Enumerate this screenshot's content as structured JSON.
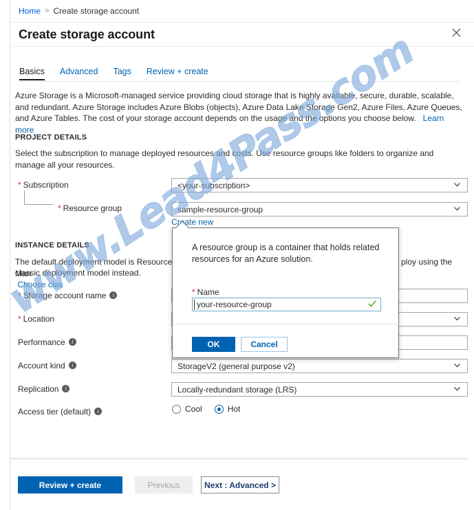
{
  "breadcrumb": {
    "home": "Home",
    "separator": ">",
    "current": "Create storage account"
  },
  "header": {
    "title": "Create storage account",
    "close_icon": "close-icon"
  },
  "tabs": [
    {
      "label": "Basics",
      "active": true
    },
    {
      "label": "Advanced",
      "active": false
    },
    {
      "label": "Tags",
      "active": false
    },
    {
      "label": "Review + create",
      "active": false
    }
  ],
  "intro": {
    "text": "Azure Storage is a Microsoft-managed service providing cloud storage that is highly available, secure, durable, scalable, and redundant. Azure Storage includes Azure Blobs (objects), Azure Data Lake Storage Gen2, Azure Files, Azure Queues, and Azure Tables. The cost of your storage account depends on the usage and the options you choose below.",
    "learn_more": "Learn more"
  },
  "project_details": {
    "heading": "PROJECT DETAILS",
    "description": "Select the subscription to manage deployed resources and costs. Use resource groups like folders to organize and manage all your resources.",
    "subscription": {
      "label": "Subscription",
      "required": "*",
      "value": "<your-subscription>"
    },
    "resource_group": {
      "label": "Resource group",
      "required": "*",
      "value": "sample-resource-group",
      "create_new": "Create new"
    }
  },
  "instance_details": {
    "heading": "INSTANCE DETAILS",
    "description_before": "The default deployment model is Resource Man",
    "description_after": "ploy using the",
    "description_line2": "classic deployment model instead.",
    "choose_classic": "Choose clas",
    "fields": [
      {
        "label": "Storage account name",
        "required": "*",
        "info": true,
        "value": "",
        "chevron": false
      },
      {
        "label": "Location",
        "required": "*",
        "info": false,
        "value": "",
        "chevron": true
      },
      {
        "label": "Performance",
        "required": "",
        "info": true,
        "value": "",
        "chevron": false
      },
      {
        "label": "Account kind",
        "required": "",
        "info": true,
        "value": "StorageV2 (general purpose v2)",
        "chevron": true
      },
      {
        "label": "Replication",
        "required": "",
        "info": true,
        "value": "Locally-redundant storage (LRS)",
        "chevron": true
      }
    ],
    "access_tier": {
      "label": "Access tier (default)",
      "info": true,
      "options": [
        {
          "label": "Cool",
          "selected": false
        },
        {
          "label": "Hot",
          "selected": true
        }
      ]
    }
  },
  "callout": {
    "text": "A resource group is a container that holds related resources for an Azure solution.",
    "name_label": "Name",
    "name_required": "*",
    "name_value": "your-resource-group",
    "valid_icon": "checkmark-icon",
    "ok": "OK",
    "cancel": "Cancel"
  },
  "footer": {
    "review_create": "Review + create",
    "previous": "Previous",
    "next": "Next : Advanced >"
  },
  "watermark": {
    "text": "www.Lead4Pass.com"
  },
  "colors": {
    "accent": "#0063b1",
    "link": "#0063b1",
    "required": "#c9283d",
    "valid": "#4caf1f",
    "watermark": "#7fa9dd"
  }
}
